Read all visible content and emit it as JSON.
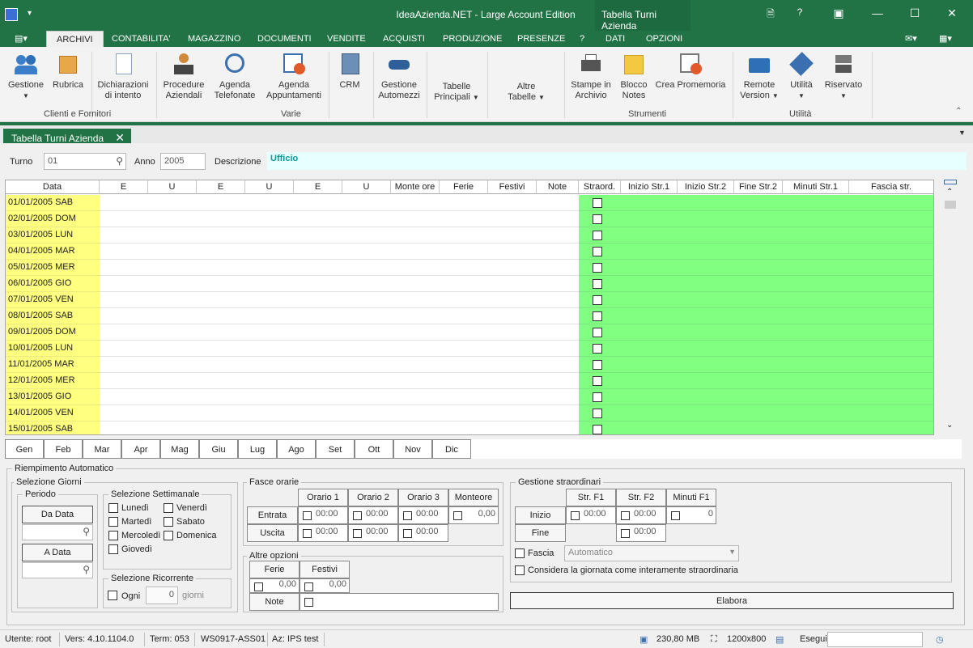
{
  "window": {
    "title": "IdeaAzienda.NET - Large Account Edition",
    "context_tab": "Tabella Turni Azienda",
    "help": "?"
  },
  "menu": {
    "items": [
      "ARCHIVI",
      "CONTABILITA'",
      "MAGAZZINO",
      "DOCUMENTI",
      "VENDITE",
      "ACQUISTI",
      "PRODUZIONE",
      "PRESENZE",
      "?"
    ],
    "context_items": [
      "DATI",
      "OPZIONI"
    ]
  },
  "ribbon": {
    "buttons": {
      "gestione": "Gestione",
      "rubrica": "Rubrica",
      "dichiarazioni": [
        "Dichiarazioni",
        "di intento"
      ],
      "procedure": [
        "Procedure",
        "Aziendali"
      ],
      "agenda_tel": [
        "Agenda",
        "Telefonate"
      ],
      "agenda_app": [
        "Agenda",
        "Appuntamenti"
      ],
      "crm": "CRM",
      "automezzi": [
        "Gestione",
        "Automezzi"
      ],
      "tabelle": [
        "Tabelle",
        "Principali"
      ],
      "altre": [
        "Altre",
        "Tabelle"
      ],
      "stampe": [
        "Stampe in",
        "Archivio"
      ],
      "blocco": [
        "Blocco",
        "Notes"
      ],
      "promemoria": "Crea Promemoria",
      "remote": [
        "Remote",
        "Version"
      ],
      "utilita": "Utilità",
      "riservato": "Riservato"
    },
    "groups": {
      "clienti": "Clienti e Fornitori",
      "varie": "Varie",
      "strumenti": "Strumenti",
      "utilita": "Utilità"
    }
  },
  "document_tab": "Tabella Turni Azienda",
  "header_form": {
    "turno_label": "Turno",
    "turno_value": "01",
    "anno_label": "Anno",
    "anno_value": "2005",
    "descrizione_label": "Descrizione",
    "descrizione_value": "Ufficio"
  },
  "grid": {
    "columns": [
      "Data",
      "E",
      "U",
      "E",
      "U",
      "E",
      "U",
      "Monte ore",
      "Ferie",
      "Festivi",
      "Note",
      "Straord.",
      "Inizio Str.1",
      "Inizio Str.2",
      "Fine Str.2",
      "Minuti Str.1",
      "Fascia str."
    ],
    "rows": [
      "01/01/2005 SAB",
      "02/01/2005 DOM",
      "03/01/2005 LUN",
      "04/01/2005 MAR",
      "05/01/2005 MER",
      "06/01/2005 GIO",
      "07/01/2005 VEN",
      "08/01/2005 SAB",
      "09/01/2005 DOM",
      "10/01/2005 LUN",
      "11/01/2005 MAR",
      "12/01/2005 MER",
      "13/01/2005 GIO",
      "14/01/2005 VEN",
      "15/01/2005 SAB"
    ]
  },
  "months": [
    "Gen",
    "Feb",
    "Mar",
    "Apr",
    "Mag",
    "Giu",
    "Lug",
    "Ago",
    "Set",
    "Ott",
    "Nov",
    "Dic"
  ],
  "riempimento": {
    "title": "Riempimento Automatico",
    "selezione_giorni": "Selezione Giorni",
    "periodo": "Periodo",
    "da_data": "Da Data",
    "a_data": "A Data",
    "selezione_settimanale": "Selezione Settimanale",
    "days": [
      "Lunedì",
      "Martedì",
      "Mercoledì",
      "Giovedì",
      "Venerdì",
      "Sabato",
      "Domenica"
    ],
    "selezione_ricorrente": "Selezione Ricorrente",
    "ogni": "Ogni",
    "ogni_value": "0",
    "giorni": "giorni"
  },
  "fasce": {
    "title": "Fasce orarie",
    "headers": [
      "Orario 1",
      "Orario 2",
      "Orario 3",
      "Monteore"
    ],
    "entrata": "Entrata",
    "uscita": "Uscita",
    "time": "00:00",
    "monteore_value": "0,00"
  },
  "altre_opzioni": {
    "title": "Altre opzioni",
    "ferie": "Ferie",
    "festivi": "Festivi",
    "ferie_value": "0,00",
    "festivi_value": "0,00",
    "note": "Note"
  },
  "straordinari": {
    "title": "Gestione straordinari",
    "headers": [
      "Str. F1",
      "Str. F2",
      "Minuti F1"
    ],
    "inizio": "Inizio",
    "fine": "Fine",
    "time": "00:00",
    "minuti_value": "0",
    "fascia_label": "Fascia",
    "fascia_value": "Automatico",
    "considera": "Considera la giornata come interamente straordinaria",
    "elabora": "Elabora"
  },
  "status": {
    "utente": "Utente: root",
    "versione": "Vers: 4.10.1104.0",
    "term": "Term: 053",
    "ws": "WS0917-ASS01",
    "az": "Az: IPS test",
    "memory": "230,80 MB",
    "resolution": "1200x800",
    "esegui": "Esegui"
  },
  "colors": {
    "brand": "#217346",
    "date_cell": "#ffff80",
    "overtime_cell": "#80ff80",
    "description": "#e8ffff"
  }
}
